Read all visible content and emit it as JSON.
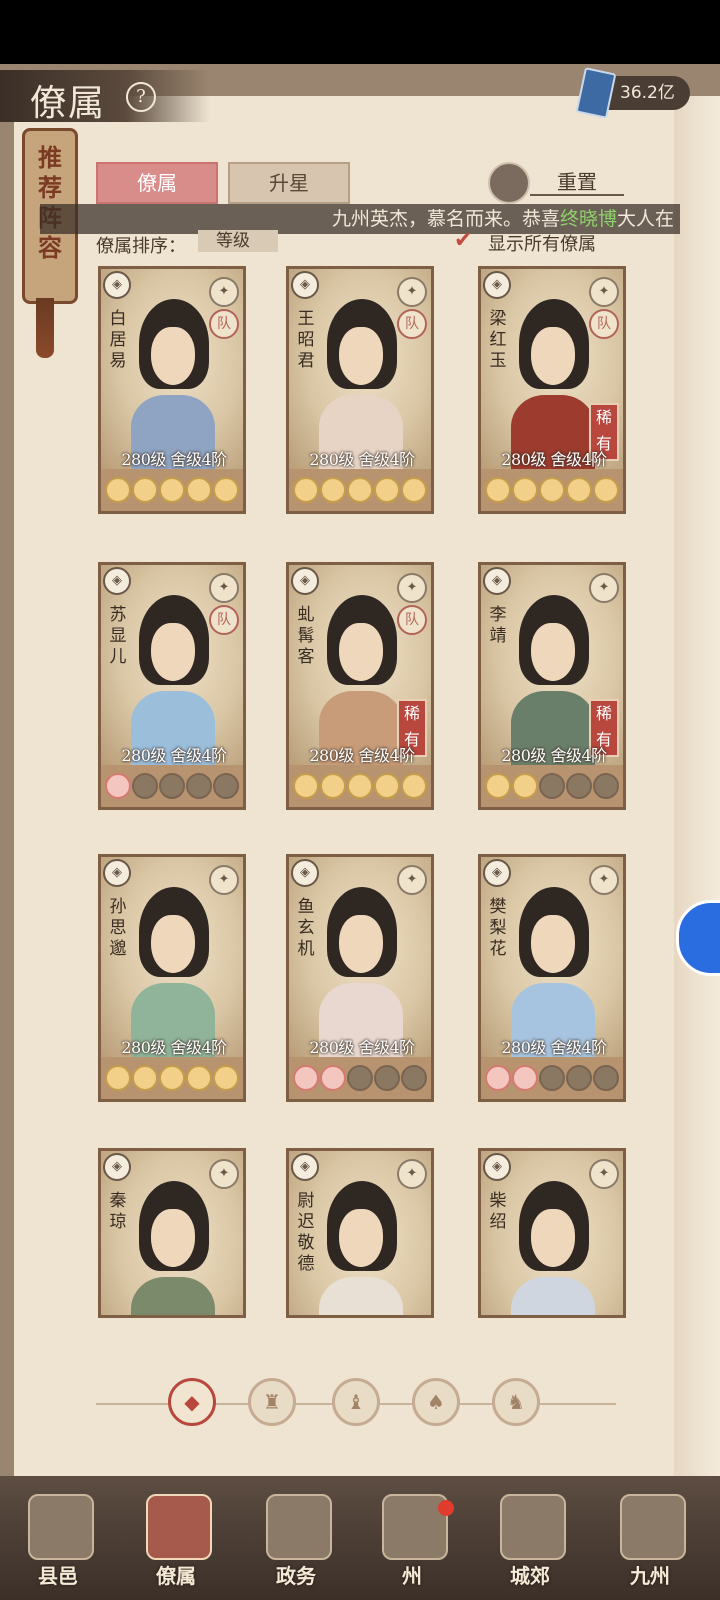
{
  "header": {
    "title": "僚属",
    "help": "?",
    "currency": "36.2亿"
  },
  "recommend": {
    "label": "推荐阵容"
  },
  "tabs": [
    {
      "label": "僚属"
    },
    {
      "label": "升星"
    }
  ],
  "reset_label": "重置",
  "marquee": {
    "prefix": "九州英杰，慕名而来。恭喜",
    "player": "终晓博",
    "suffix": "大人在"
  },
  "sort": {
    "label": "僚属排序：",
    "value": "等级"
  },
  "show_all": {
    "label": "显示所有僚属",
    "checked": true
  },
  "cards": [
    {
      "name": "白居易",
      "level": "280级",
      "stage": "舍级4阶",
      "rare": "",
      "moons": [
        "y",
        "y",
        "y",
        "y",
        "y"
      ],
      "team": "队",
      "robe": "#8fa4c2"
    },
    {
      "name": "王昭君",
      "level": "280级",
      "stage": "舍级4阶",
      "rare": "",
      "moons": [
        "y",
        "y",
        "y",
        "y",
        "y"
      ],
      "team": "队",
      "robe": "#e8d4c4"
    },
    {
      "name": "梁红玉",
      "level": "280级",
      "stage": "舍级4阶",
      "rare": "稀有",
      "moons": [
        "y",
        "y",
        "y",
        "y",
        "y"
      ],
      "team": "队",
      "robe": "#9c3b2e"
    },
    {
      "name": "苏显儿",
      "level": "280级",
      "stage": "舍级4阶",
      "rare": "",
      "moons": [
        "r",
        "g",
        "g",
        "g",
        "g"
      ],
      "team": "队",
      "robe": "#9bbedb"
    },
    {
      "name": "虬髯客",
      "level": "280级",
      "stage": "舍级4阶",
      "rare": "稀有",
      "moons": [
        "y",
        "y",
        "y",
        "y",
        "y"
      ],
      "team": "队",
      "robe": "#c89c78"
    },
    {
      "name": "李靖",
      "level": "280级",
      "stage": "舍级4阶",
      "rare": "稀有",
      "moons": [
        "y",
        "y",
        "g",
        "g",
        "g"
      ],
      "team": "",
      "robe": "#6a7f6a"
    },
    {
      "name": "孙思邈",
      "level": "280级",
      "stage": "舍级4阶",
      "rare": "",
      "moons": [
        "y",
        "y",
        "y",
        "y",
        "y"
      ],
      "team": "",
      "robe": "#8fb49a"
    },
    {
      "name": "鱼玄机",
      "level": "280级",
      "stage": "舍级4阶",
      "rare": "",
      "moons": [
        "r",
        "r",
        "g",
        "g",
        "g"
      ],
      "team": "",
      "robe": "#e8d8d0"
    },
    {
      "name": "樊梨花",
      "level": "280级",
      "stage": "舍级4阶",
      "rare": "",
      "moons": [
        "r",
        "r",
        "g",
        "g",
        "g"
      ],
      "team": "",
      "robe": "#a6c4e0"
    },
    {
      "name": "秦琼",
      "level": "",
      "stage": "",
      "rare": "",
      "moons": [],
      "team": "",
      "robe": "#7a8a6a"
    },
    {
      "name": "尉迟敬德",
      "level": "",
      "stage": "",
      "rare": "",
      "moons": [],
      "team": "",
      "robe": "#e8e0d4"
    },
    {
      "name": "柴绍",
      "level": "",
      "stage": "",
      "rare": "",
      "moons": [],
      "team": "",
      "robe": "#cfd6e0"
    }
  ],
  "nav": [
    {
      "label": "县邑"
    },
    {
      "label": "僚属"
    },
    {
      "label": "政务"
    },
    {
      "label": "州"
    },
    {
      "label": "城郊"
    },
    {
      "label": "九州"
    }
  ],
  "colors": {
    "accent": "#b8473e",
    "highlight": "#8fd16a",
    "paper": "#efe4d2"
  }
}
